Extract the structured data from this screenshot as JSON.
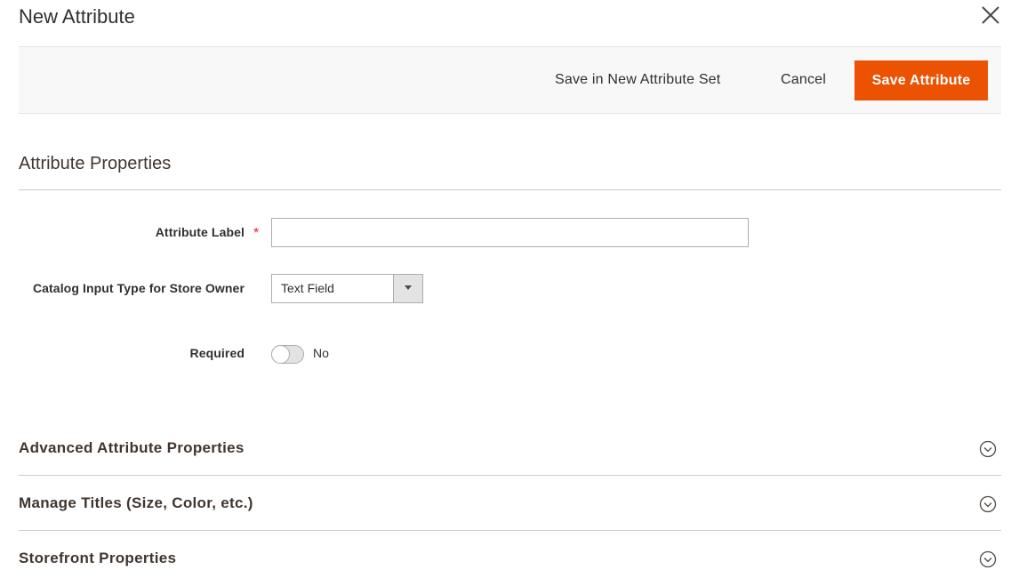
{
  "modal": {
    "title": "New Attribute",
    "close_icon": "close-icon"
  },
  "toolbar": {
    "save_in_set_label": "Save in New Attribute Set",
    "cancel_label": "Cancel",
    "save_label": "Save Attribute",
    "accent_color": "#eb5202"
  },
  "attribute_properties": {
    "title": "Attribute Properties",
    "attribute_label": {
      "label": "Attribute Label",
      "required_mark": "*",
      "value": "",
      "placeholder": ""
    },
    "input_type": {
      "label": "Catalog Input Type for Store Owner",
      "selected": "Text Field"
    },
    "required": {
      "label": "Required",
      "state_text": "No",
      "on": false
    }
  },
  "sections": [
    {
      "title": "Advanced Attribute Properties",
      "icon": "chevron-down-circle-icon"
    },
    {
      "title": "Manage Titles (Size, Color, etc.)",
      "icon": "chevron-down-circle-icon"
    },
    {
      "title": "Storefront Properties",
      "icon": "chevron-down-circle-icon"
    }
  ]
}
